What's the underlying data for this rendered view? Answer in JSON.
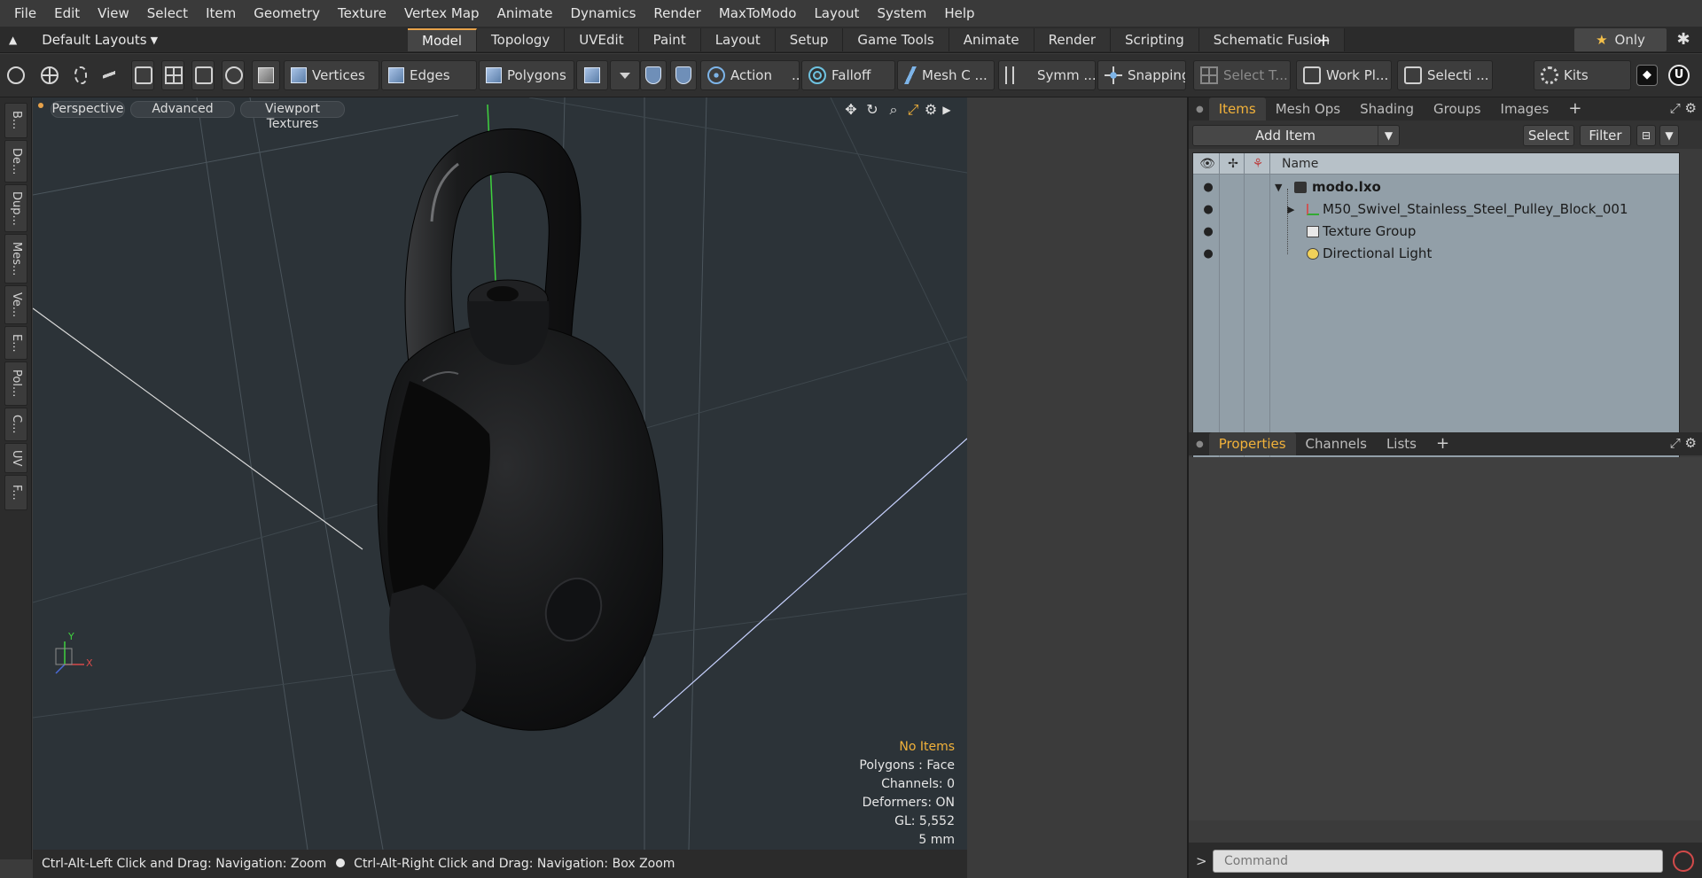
{
  "menu": [
    "File",
    "Edit",
    "View",
    "Select",
    "Item",
    "Geometry",
    "Texture",
    "Vertex Map",
    "Animate",
    "Dynamics",
    "Render",
    "MaxToModo",
    "Layout",
    "System",
    "Help"
  ],
  "layout_selector": "Default Layouts",
  "tabs": [
    "Model",
    "Topology",
    "UVEdit",
    "Paint",
    "Layout",
    "Setup",
    "Game Tools",
    "Animate",
    "Render",
    "Scripting",
    "Schematic Fusion"
  ],
  "active_tab": "Model",
  "only_label": "Only",
  "toolbar": {
    "vertices": "Vertices",
    "edges": "Edges",
    "polygons": "Polygons",
    "action": "Action",
    "action_more": "...",
    "falloff": "Falloff",
    "mesh": "Mesh C ...",
    "symmetry": "Symm ...",
    "snapping": "Snapping",
    "select_t": "Select T...",
    "work_plane": "Work Pl...",
    "selection": "Selecti ...",
    "kits": "Kits",
    "unity": "◆",
    "unreal": "U"
  },
  "left_strip": [
    "B...",
    "De...",
    "Dup...",
    "Mes...",
    "Ve...",
    "E...",
    "Pol...",
    "C...",
    "UV",
    "F..."
  ],
  "viewport": {
    "perspective": "Perspective",
    "advanced": "Advanced",
    "textures": "Viewport Textures",
    "info": [
      "No Items",
      "Polygons : Face",
      "Channels: 0",
      "Deformers: ON",
      "GL: 5,552",
      "5 mm"
    ],
    "axis_x": "X",
    "axis_y": "Y"
  },
  "status": {
    "left": "Ctrl-Alt-Left Click and Drag: Navigation: Zoom",
    "right": "Ctrl-Alt-Right Click and Drag: Navigation: Box Zoom"
  },
  "items_panel": {
    "tabs": [
      "Items",
      "Mesh Ops",
      "Shading",
      "Groups",
      "Images"
    ],
    "add_item": "Add Item",
    "select": "Select",
    "filter": "Filter",
    "name_header": "Name",
    "rows": [
      {
        "label": "modo.lxo"
      },
      {
        "label": "M50_Swivel_Stainless_Steel_Pulley_Block_001"
      },
      {
        "label": "Texture Group"
      },
      {
        "label": "Directional Light"
      }
    ]
  },
  "props_panel": {
    "tabs": [
      "Properties",
      "Channels",
      "Lists"
    ]
  },
  "command": {
    "prompt": ">",
    "placeholder": "Command"
  },
  "colors": {
    "accent": "#f2b23a",
    "viewport_bg": "#2c3338",
    "tree_bg": "#929fa8",
    "y_axis": "#3fd13f"
  }
}
